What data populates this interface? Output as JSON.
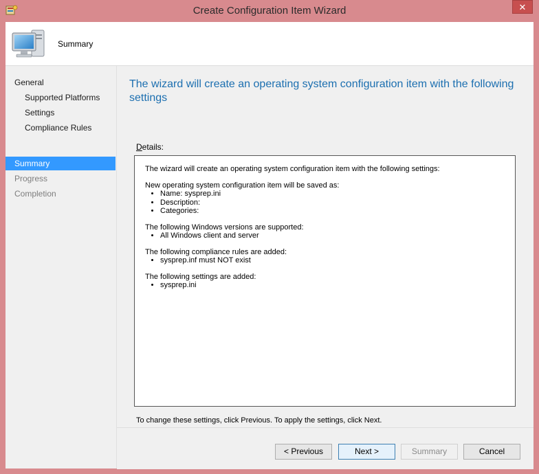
{
  "window": {
    "title": "Create Configuration Item Wizard",
    "close_label": "✕"
  },
  "header": {
    "title": "Summary",
    "icon": "computer-icon"
  },
  "nav": {
    "items": [
      {
        "label": "General",
        "level": 0,
        "state": "normal"
      },
      {
        "label": "Supported Platforms",
        "level": 1,
        "state": "normal"
      },
      {
        "label": "Settings",
        "level": 1,
        "state": "normal"
      },
      {
        "label": "Compliance Rules",
        "level": 1,
        "state": "normal"
      },
      {
        "label": "Summary",
        "level": 0,
        "state": "selected"
      },
      {
        "label": "Progress",
        "level": 0,
        "state": "disabled"
      },
      {
        "label": "Completion",
        "level": 0,
        "state": "disabled"
      }
    ]
  },
  "content": {
    "heading": "The wizard will create an operating system configuration item with the following settings",
    "details_label_accel": "D",
    "details_label_rest": "etails:",
    "details": {
      "intro": "The wizard will create an operating system configuration item with the following settings:",
      "sections": [
        {
          "title": "New operating system configuration item will be saved as:",
          "items": [
            "Name: sysprep.ini",
            "Description:",
            "Categories:"
          ]
        },
        {
          "title": "The following Windows versions are supported:",
          "items": [
            "All Windows client and server"
          ]
        },
        {
          "title": "The following compliance rules are added:",
          "items": [
            "sysprep.inf must NOT exist"
          ]
        },
        {
          "title": "The following settings are added:",
          "items": [
            "sysprep.ini"
          ]
        }
      ]
    },
    "hint": "To change these settings, click Previous. To apply the settings, click Next."
  },
  "buttons": {
    "previous_label": "< Previous",
    "next_label": "Next >",
    "summary_label": "Summary",
    "cancel_label": "Cancel"
  },
  "colors": {
    "accent": "#3399ff",
    "heading": "#1c6fb0",
    "frame": "#d88a8e"
  }
}
